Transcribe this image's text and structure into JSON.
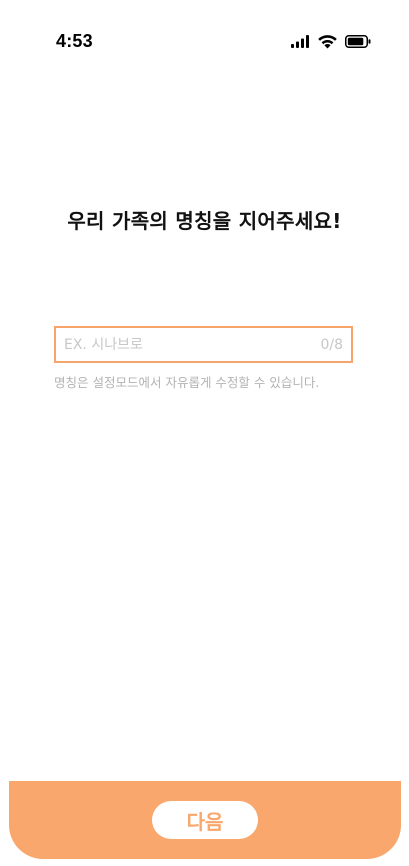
{
  "status_bar": {
    "time": "4:53",
    "icons": [
      "cellular-signal-icon",
      "wifi-icon",
      "battery-icon"
    ]
  },
  "main": {
    "title": "우리 가족의 명칭을 지어주세요!",
    "name_input": {
      "value": "",
      "placeholder": "EX. 시나브로",
      "counter": "0/8"
    },
    "helper_text": "명칭은 설정모드에서 자유롭게 수정할 수 있습니다."
  },
  "footer": {
    "next_label": "다음"
  },
  "colors": {
    "accent": "#f9a76c",
    "input_border": "#f7a56b",
    "placeholder": "#c7c7c7",
    "helper": "#b3b3b3",
    "title": "#111111"
  }
}
